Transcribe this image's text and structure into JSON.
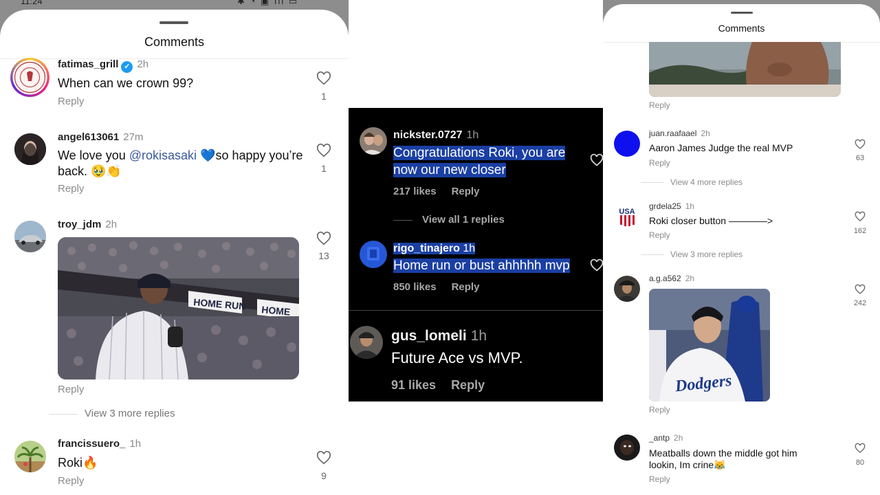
{
  "left": {
    "status": {
      "time": "11:24",
      "icons": "✱ ◔ ▣ ıll ▭"
    },
    "sheet_title": "Comments",
    "comments": [
      {
        "username": "fatimas_grill",
        "verified": true,
        "time": "2h",
        "text": "When can we crown 99?",
        "reply": "Reply",
        "likes": "1",
        "avatar": "fatimas-grill-logo"
      },
      {
        "username": "angel613061",
        "time": "27m",
        "text_pre": "We love you ",
        "mention": "@rokisasaki",
        "text_post": " 💙so happy you’re back. 🥹👏",
        "reply": "Reply",
        "likes": "1"
      },
      {
        "username": "troy_jdm",
        "time": "2h",
        "image": {
          "sign_1": "HOME RUN",
          "sign_2": "HOME"
        },
        "reply": "Reply",
        "likes": "13",
        "view_more": "View 3 more replies"
      },
      {
        "username": "francissuero_",
        "time": "1h",
        "text": "Roki🔥",
        "reply": "Reply",
        "likes": "9"
      }
    ]
  },
  "middle": {
    "comments": [
      {
        "username": "nickster.0727",
        "time": "1h",
        "line_1": "Congratulations Roki, you are",
        "line_2": "now our new closer",
        "likes": "217 likes",
        "reply": "Reply",
        "view_all": "View all 1 replies"
      },
      {
        "username": "rigo_tinajero",
        "time": "1h",
        "text": "Home run or bust ahhhhh mvp",
        "likes": "850 likes",
        "reply": "Reply"
      },
      {
        "username": "gus_lomeli",
        "time": "1h",
        "text": "Future Ace vs MVP.",
        "likes": "91 likes",
        "reply": "Reply"
      }
    ]
  },
  "right": {
    "sheet_title": "Comments",
    "top_reply": "Reply",
    "comments": [
      {
        "username": "juan.raafaael",
        "time": "2h",
        "text": "Aaron James Judge the real MVP",
        "reply": "Reply",
        "likes": "63",
        "view_more": "View 4 more replies"
      },
      {
        "username": "grdela25",
        "time": "1h",
        "text": "Roki closer button ————>",
        "reply": "Reply",
        "likes": "162",
        "view_more": "View 3 more replies",
        "avatar_text": "USA"
      },
      {
        "username": "a.g.a562",
        "time": "2h",
        "image": {
          "jersey": "Dodgers"
        },
        "reply": "Reply",
        "likes": "242"
      },
      {
        "username": "_antp",
        "time": "2h",
        "text_line_1": "Meatballs down the middle got him",
        "text_line_2": "lookin, Im crine😹",
        "reply": "Reply",
        "likes": "80"
      }
    ]
  }
}
